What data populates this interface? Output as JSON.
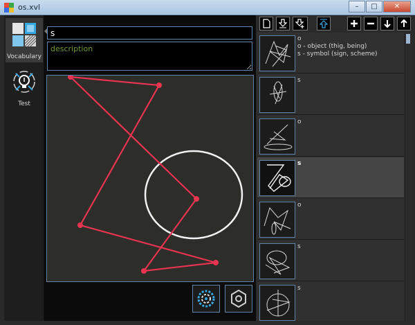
{
  "window": {
    "title": "os.xvl",
    "buttons": {
      "minimize": "–",
      "maximize": "□",
      "close": "✕"
    }
  },
  "nav": {
    "items": [
      {
        "label": "Vocabulary",
        "icon": "vocabulary-grid-icon",
        "active": true
      },
      {
        "label": "Test",
        "icon": "lightbulb-icon",
        "active": false
      }
    ]
  },
  "editor": {
    "name_value": "s",
    "description_placeholder": "description",
    "strokes": {
      "polyline_color": "#e83450",
      "polyline_points": [
        "p1",
        "p2",
        "p3",
        "p4",
        "p5",
        "p6"
      ],
      "circle_color": "#f2f2f2"
    },
    "tools": [
      {
        "icon": "spiral-icon"
      },
      {
        "icon": "hexagon-icon"
      }
    ]
  },
  "toolbar": {
    "icons": [
      "new-file-icon",
      "import-icon",
      "import-add-icon",
      "export-icon",
      "add-icon",
      "remove-icon",
      "move-down-icon",
      "move-up-icon"
    ]
  },
  "list": {
    "rows": [
      {
        "text": "o\no - object (thig, being)\ns - symbol (sign, scheme)",
        "selected": false
      },
      {
        "text": "s",
        "selected": false
      },
      {
        "text": "o",
        "selected": false
      },
      {
        "text": "s",
        "selected": true
      },
      {
        "text": "o",
        "selected": false
      },
      {
        "text": "s",
        "selected": false
      },
      {
        "text": "s",
        "selected": false
      }
    ]
  },
  "colors": {
    "accent_border": "#5f86a8",
    "stroke_red": "#e83450",
    "description_green": "#6f9a2f"
  }
}
